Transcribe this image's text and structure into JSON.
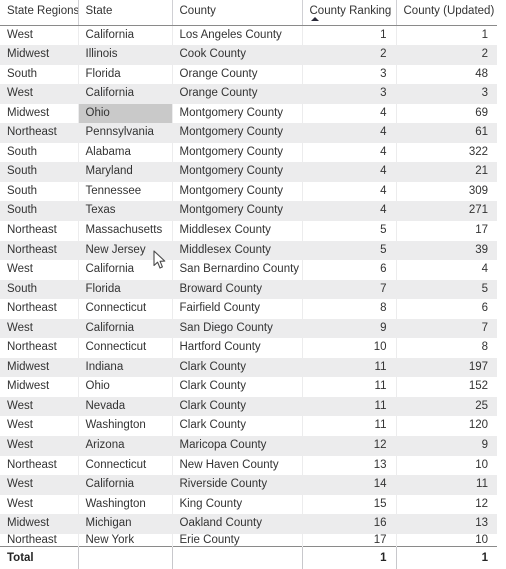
{
  "table": {
    "columns": [
      {
        "key": "region",
        "label": "State Regions",
        "align": "left",
        "sorted": false
      },
      {
        "key": "state",
        "label": "State",
        "align": "left",
        "sorted": false
      },
      {
        "key": "county",
        "label": "County",
        "align": "left",
        "sorted": false
      },
      {
        "key": "rank",
        "label": "County Ranking",
        "align": "right",
        "sorted": true,
        "sort_direction": "ascending",
        "sort_icon": "sort-ascending-icon"
      },
      {
        "key": "updated",
        "label": "County (Updated)",
        "align": "right",
        "sorted": false
      }
    ],
    "rows": [
      {
        "region": "West",
        "state": "California",
        "county": "Los Angeles County",
        "rank": "1",
        "updated": "1"
      },
      {
        "region": "Midwest",
        "state": "Illinois",
        "county": "Cook County",
        "rank": "2",
        "updated": "2"
      },
      {
        "region": "South",
        "state": "Florida",
        "county": "Orange County",
        "rank": "3",
        "updated": "48"
      },
      {
        "region": "West",
        "state": "California",
        "county": "Orange County",
        "rank": "3",
        "updated": "3"
      },
      {
        "region": "Midwest",
        "state": "Ohio",
        "county": "Montgomery County",
        "rank": "4",
        "updated": "69",
        "selected_cell": "state"
      },
      {
        "region": "Northeast",
        "state": "Pennsylvania",
        "county": "Montgomery County",
        "rank": "4",
        "updated": "61"
      },
      {
        "region": "South",
        "state": "Alabama",
        "county": "Montgomery County",
        "rank": "4",
        "updated": "322"
      },
      {
        "region": "South",
        "state": "Maryland",
        "county": "Montgomery County",
        "rank": "4",
        "updated": "21"
      },
      {
        "region": "South",
        "state": "Tennessee",
        "county": "Montgomery County",
        "rank": "4",
        "updated": "309"
      },
      {
        "region": "South",
        "state": "Texas",
        "county": "Montgomery County",
        "rank": "4",
        "updated": "271"
      },
      {
        "region": "Northeast",
        "state": "Massachusetts",
        "county": "Middlesex County",
        "rank": "5",
        "updated": "17"
      },
      {
        "region": "Northeast",
        "state": "New Jersey",
        "county": "Middlesex County",
        "rank": "5",
        "updated": "39"
      },
      {
        "region": "West",
        "state": "California",
        "county": "San Bernardino County",
        "rank": "6",
        "updated": "4"
      },
      {
        "region": "South",
        "state": "Florida",
        "county": "Broward County",
        "rank": "7",
        "updated": "5"
      },
      {
        "region": "Northeast",
        "state": "Connecticut",
        "county": "Fairfield County",
        "rank": "8",
        "updated": "6"
      },
      {
        "region": "West",
        "state": "California",
        "county": "San Diego County",
        "rank": "9",
        "updated": "7"
      },
      {
        "region": "Northeast",
        "state": "Connecticut",
        "county": "Hartford County",
        "rank": "10",
        "updated": "8"
      },
      {
        "region": "Midwest",
        "state": "Indiana",
        "county": "Clark County",
        "rank": "11",
        "updated": "197"
      },
      {
        "region": "Midwest",
        "state": "Ohio",
        "county": "Clark County",
        "rank": "11",
        "updated": "152"
      },
      {
        "region": "West",
        "state": "Nevada",
        "county": "Clark County",
        "rank": "11",
        "updated": "25"
      },
      {
        "region": "West",
        "state": "Washington",
        "county": "Clark County",
        "rank": "11",
        "updated": "120"
      },
      {
        "region": "West",
        "state": "Arizona",
        "county": "Maricopa County",
        "rank": "12",
        "updated": "9"
      },
      {
        "region": "Northeast",
        "state": "Connecticut",
        "county": "New Haven County",
        "rank": "13",
        "updated": "10"
      },
      {
        "region": "West",
        "state": "California",
        "county": "Riverside County",
        "rank": "14",
        "updated": "11"
      },
      {
        "region": "West",
        "state": "Washington",
        "county": "King County",
        "rank": "15",
        "updated": "12"
      },
      {
        "region": "Midwest",
        "state": "Michigan",
        "county": "Oakland County",
        "rank": "16",
        "updated": "13"
      },
      {
        "region": "Northeast",
        "state": "New York",
        "county": "Erie County",
        "rank": "17",
        "updated": "10",
        "clipped": true
      }
    ],
    "total_row": {
      "label": "Total",
      "state": "",
      "county": "",
      "rank": "1",
      "updated": "1"
    }
  },
  "pointer": {
    "icon": "mouse-cursor-icon",
    "x": "153",
    "y": "250"
  },
  "colors": {
    "header_text": "#333333",
    "row_stripe": "#ececed",
    "row_base": "#ffffff",
    "selection": "#c9c9c9",
    "grid_line": "#8a8a8a"
  }
}
